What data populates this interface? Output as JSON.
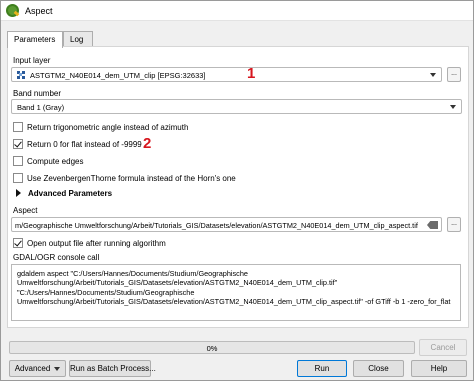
{
  "window": {
    "title": "Aspect"
  },
  "tabs": [
    {
      "label": "Parameters",
      "active": true
    },
    {
      "label": "Log",
      "active": false
    }
  ],
  "input_layer": {
    "label": "Input layer",
    "value": "ASTGTM2_N40E014_dem_UTM_clip [EPSG:32633]",
    "annotation": "1",
    "browse_label": "..."
  },
  "band_number": {
    "label": "Band number",
    "value": "Band 1 (Gray)"
  },
  "checkboxes": [
    {
      "label": "Return trigonometric angle instead of azimuth",
      "checked": false
    },
    {
      "label": "Return 0 for flat instead of -9999",
      "checked": true,
      "annotation": "2"
    },
    {
      "label": "Compute edges",
      "checked": false
    },
    {
      "label": "Use ZevenbergenThorne formula instead of the Horn's one",
      "checked": false
    }
  ],
  "advanced_parameters": {
    "label": "Advanced Parameters"
  },
  "aspect_output": {
    "label": "Aspect",
    "value": "m/Geographische Umweltforschung/Arbeit/Tutorials_GIS/Datasets/elevation/ASTGTM2_N40E014_dem_UTM_clip_aspect.tif",
    "browse_label": "...",
    "open_after": {
      "label": "Open output file after running algorithm",
      "checked": true
    }
  },
  "console": {
    "label": "GDAL/OGR console call",
    "text": "gdaldem aspect \"C:/Users/Hannes/Documents/Studium/Geographische Umweltforschung/Arbeit/Tutorials_GIS/Datasets/elevation/ASTGTM2_N40E014_dem_UTM_clip.tif\" \"C:/Users/Hannes/Documents/Studium/Geographische Umweltforschung/Arbeit/Tutorials_GIS/Datasets/elevation/ASTGTM2_N40E014_dem_UTM_clip_aspect.tif\" -of GTiff -b 1 -zero_for_flat"
  },
  "progress": {
    "text": "0%",
    "value": 0
  },
  "buttons": {
    "cancel": "Cancel",
    "advanced": "Advanced",
    "batch": "Run as Batch Process...",
    "run": "Run",
    "close": "Close",
    "help": "Help"
  },
  "colors": {
    "annotation": "#d7161e",
    "accent": "#0078d7"
  },
  "icons": [
    "qgis-logo-icon",
    "raster-layer-icon",
    "dropdown-arrow-icon",
    "expand-triangle-icon",
    "clear-text-icon"
  ]
}
